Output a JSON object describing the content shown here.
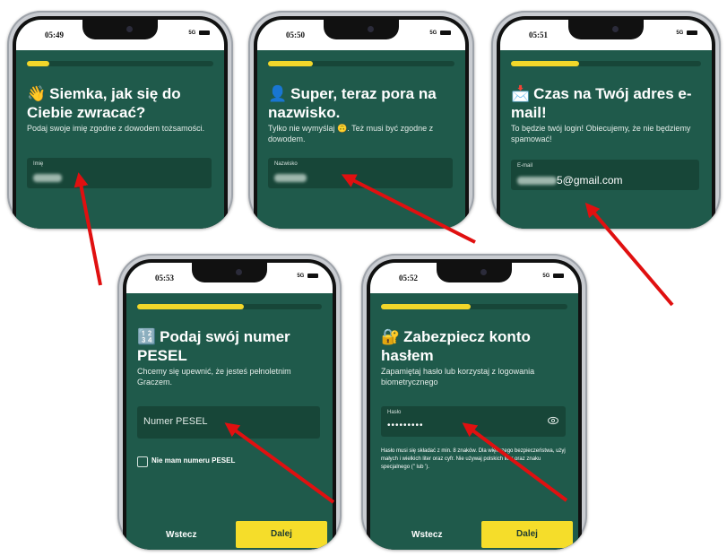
{
  "phones": {
    "p1": {
      "time": "05:49",
      "signal": "5G",
      "progress": 0.12,
      "title_emoji": "👋",
      "title": "Siemka, jak się do Ciebie zwracać?",
      "subtitle": "Podaj swoje imię zgodne z dowodem tożsamości.",
      "field_label": "Imię"
    },
    "p2": {
      "time": "05:50",
      "signal": "5G",
      "progress": 0.24,
      "title_emoji": "👤",
      "title": "Super, teraz pora na nazwisko.",
      "subtitle": "Tylko nie wymyślaj 🙃. Też musi być zgodne z dowodem.",
      "field_label": "Nazwisko"
    },
    "p3": {
      "time": "05:51",
      "signal": "5G",
      "progress": 0.36,
      "title_emoji": "📩",
      "title": "Czas na Twój adres e-mail!",
      "subtitle": "To będzie twój login! Obiecujemy, że nie będziemy spamować!",
      "field_label": "E-mail",
      "field_value_suffix": "5@gmail.com"
    },
    "p4": {
      "time": "05:53",
      "signal": "5G",
      "progress": 0.58,
      "title_emoji": "🔢",
      "title": "Podaj swój numer PESEL",
      "subtitle": "Chcemy się upewnić, że jesteś pełnoletnim Graczem.",
      "field_placeholder": "Numer PESEL",
      "checkbox_label": "Nie mam numeru PESEL",
      "back_label": "Wstecz",
      "next_label": "Dalej"
    },
    "p5": {
      "time": "05:52",
      "signal": "5G",
      "progress": 0.48,
      "title_emoji": "🔐",
      "title": "Zabezpiecz konto hasłem",
      "subtitle": "Zapamiętaj hasło lub korzystaj z logowania biometrycznego",
      "field_label": "Hasło",
      "field_value": "•••••••••",
      "hint": "Hasło musi się składać z min. 8 znaków. Dla większego bezpieczeństwa, użyj małych i wielkich liter oraz cyfr. Nie używaj polskich liter oraz znaku specjalnego (\" lub ').",
      "back_label": "Wstecz",
      "next_label": "Dalej"
    }
  },
  "colors": {
    "screen_bg": "#1f5a4b",
    "field_bg": "#174638",
    "accent_yellow": "#f5dd2a",
    "arrow_red": "#e01010"
  }
}
